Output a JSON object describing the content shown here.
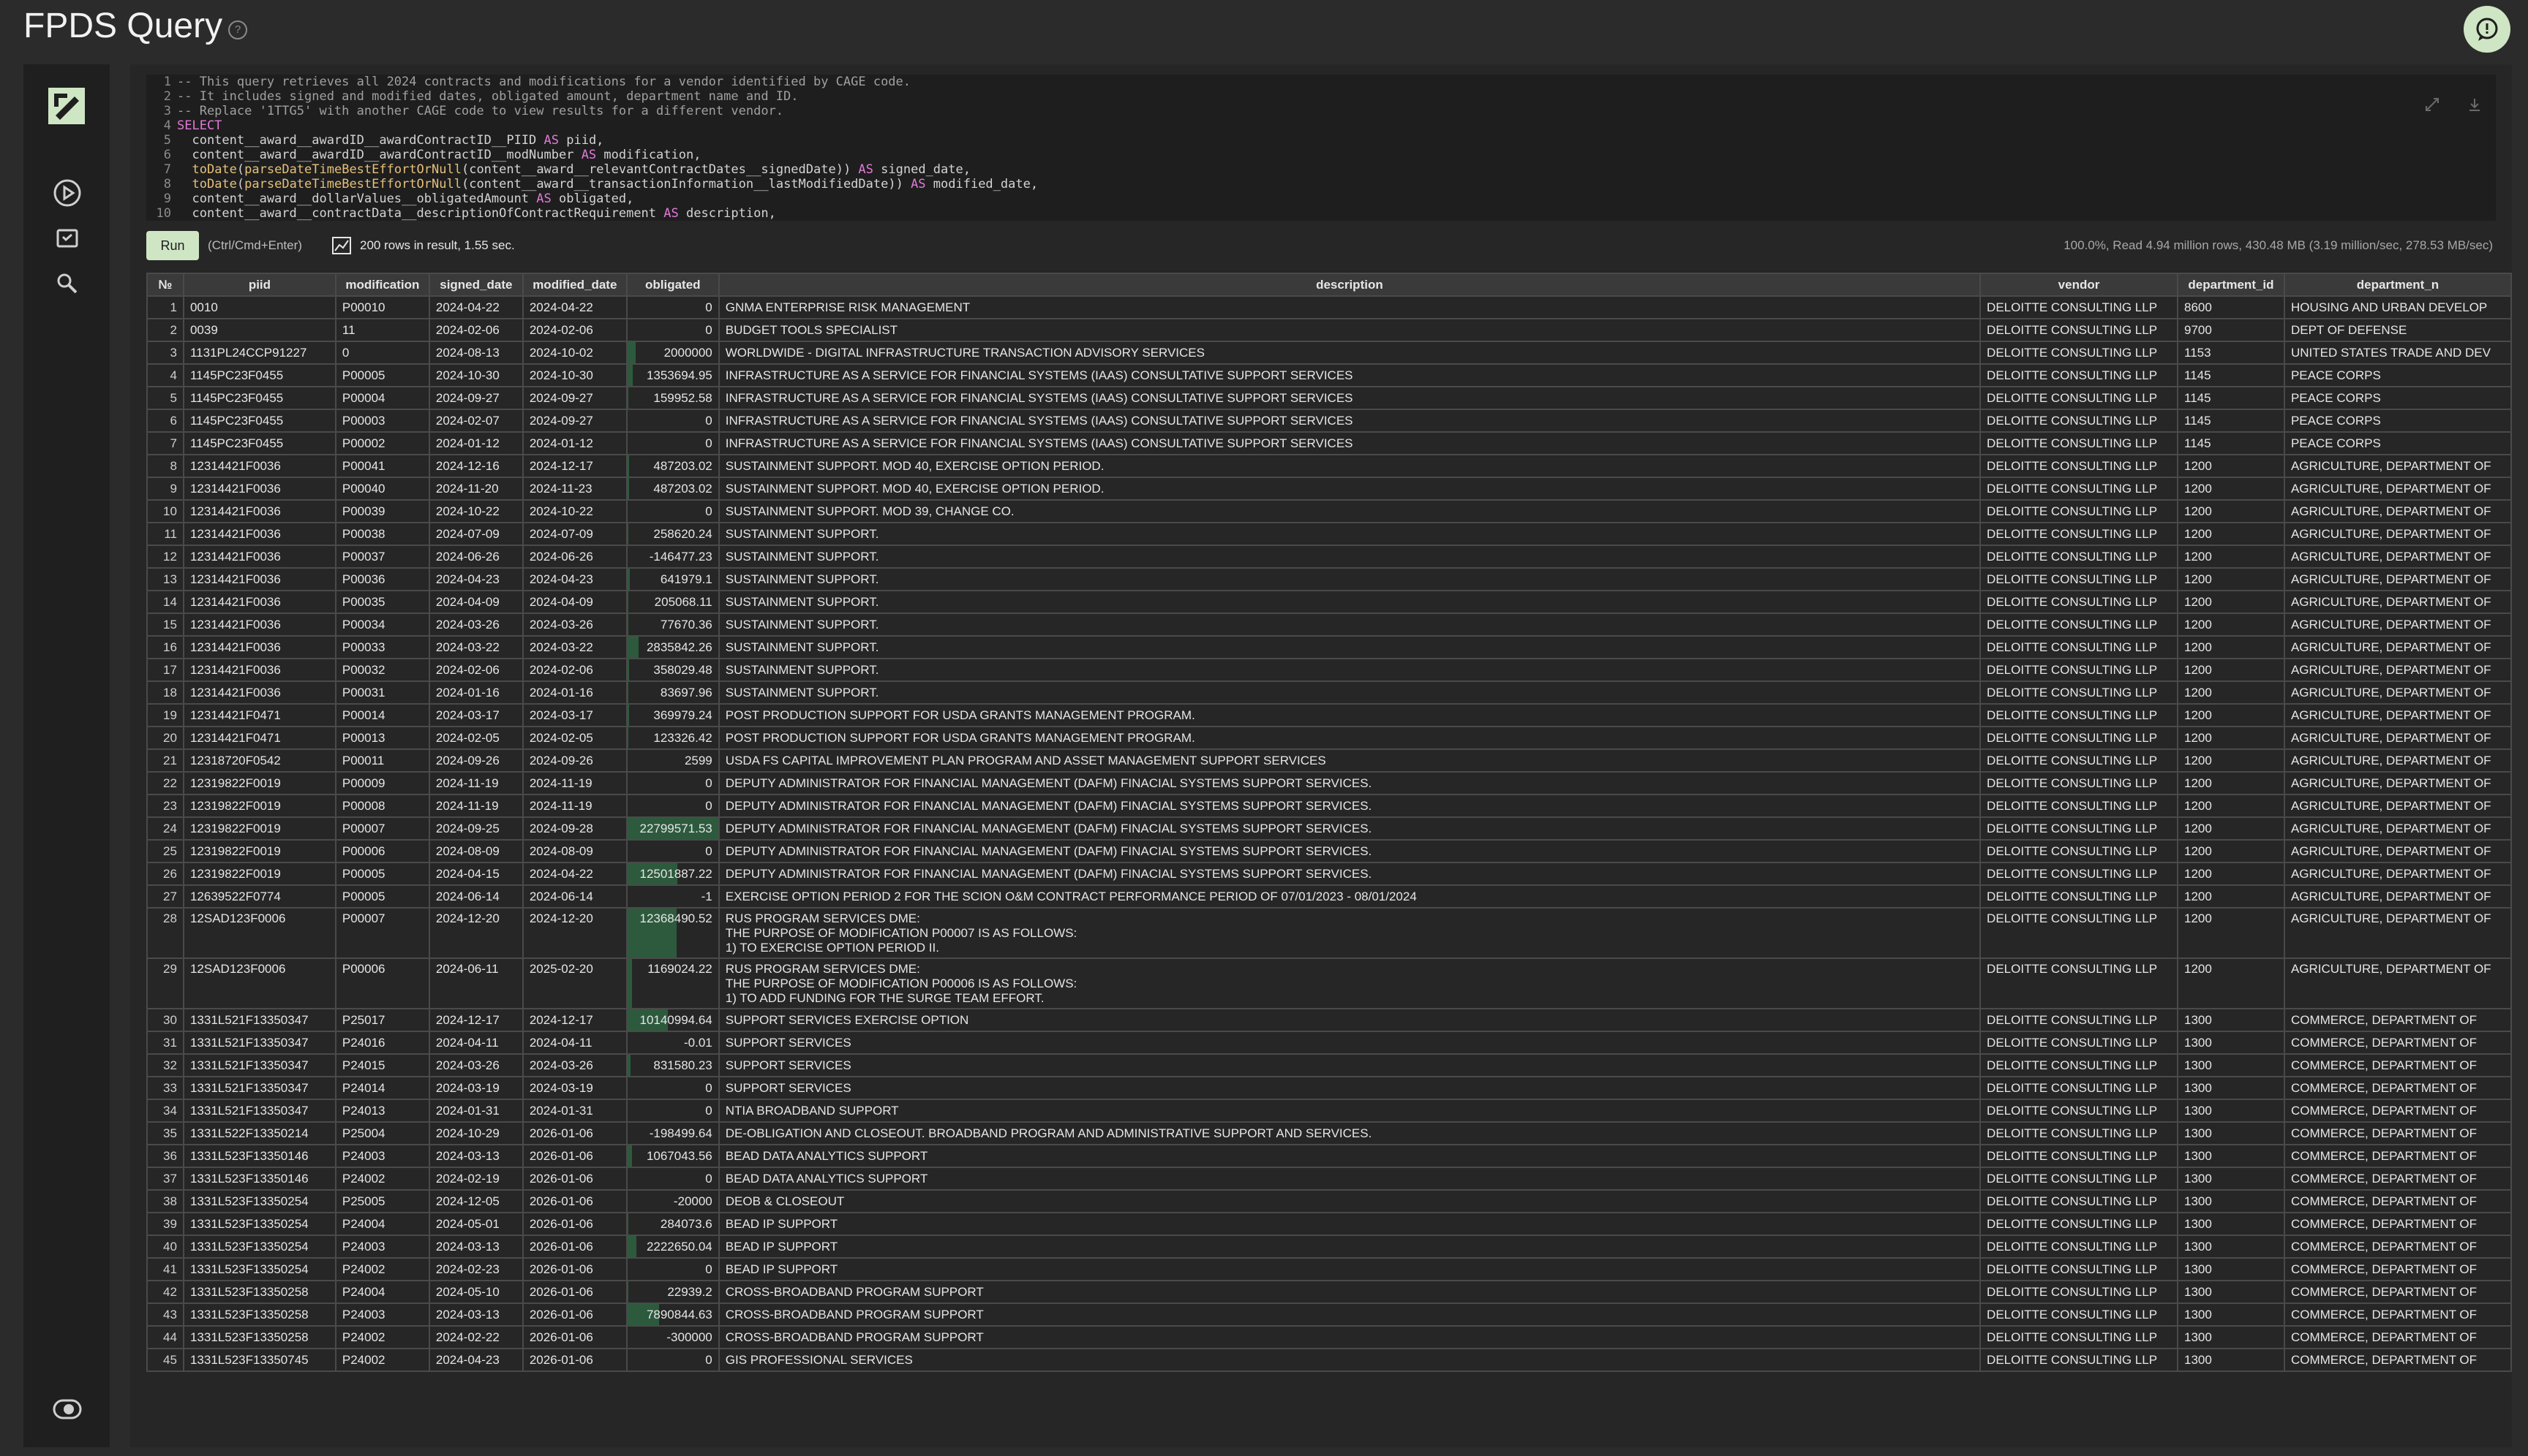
{
  "header": {
    "title": "FPDS Query",
    "help_icon": "?"
  },
  "sidebar": {
    "logo": "clickhouse-logo",
    "items": [
      "play-icon",
      "saved-queries-icon",
      "search-icon",
      "theme-toggle-icon"
    ]
  },
  "editor": {
    "lines": [
      {
        "n": "1",
        "text": "-- This query retrieves all 2024 contracts and modifications for a vendor identified by CAGE code."
      },
      {
        "n": "2",
        "text": "-- It includes signed and modified dates, obligated amount, department name and ID."
      },
      {
        "n": "3",
        "text": "-- Replace '1TTG5' with another CAGE code to view results for a different vendor."
      },
      {
        "n": "4",
        "text": "SELECT"
      },
      {
        "n": "5",
        "text": "  content__award__awardID__awardContractID__PIID AS piid,"
      },
      {
        "n": "6",
        "text": "  content__award__awardID__awardContractID__modNumber AS modification,"
      },
      {
        "n": "7",
        "text": "  toDate(parseDateTimeBestEffortOrNull(content__award__relevantContractDates__signedDate)) AS signed_date,"
      },
      {
        "n": "8",
        "text": "  toDate(parseDateTimeBestEffortOrNull(content__award__transactionInformation__lastModifiedDate)) AS modified_date,"
      },
      {
        "n": "9",
        "text": "  content__award__dollarValues__obligatedAmount AS obligated,"
      },
      {
        "n": "10",
        "text": "  content__award__contractData__descriptionOfContractRequirement AS description,"
      }
    ]
  },
  "toolbar": {
    "run_label": "Run",
    "run_hint": "(Ctrl/Cmd+Enter)",
    "result_summary": "200 rows in result, 1.55 sec.",
    "read_stats": "100.0%, Read 4.94 million rows, 430.48 MB (3.19 million/sec, 278.53 MB/sec)"
  },
  "colors": {
    "bar": "#2d5a3d",
    "accent": "#cfe6c4"
  },
  "table": {
    "columns": [
      "№",
      "piid",
      "modification",
      "signed_date",
      "modified_date",
      "obligated",
      "description",
      "vendor",
      "department_id",
      "department_n"
    ],
    "rows": [
      {
        "n": "1",
        "piid": "0010",
        "mod": "P00010",
        "signed": "2024-04-22",
        "modified": "2024-04-22",
        "obligated": "0",
        "bar": 0,
        "desc": "GNMA ENTERPRISE RISK MANAGEMENT",
        "vendor": "DELOITTE CONSULTING LLP",
        "dept_id": "8600",
        "dept": "HOUSING AND URBAN DEVELOP"
      },
      {
        "n": "2",
        "piid": "0039",
        "mod": "11",
        "signed": "2024-02-06",
        "modified": "2024-02-06",
        "obligated": "0",
        "bar": 0,
        "desc": "BUDGET TOOLS SPECIALIST",
        "vendor": "DELOITTE CONSULTING LLP",
        "dept_id": "9700",
        "dept": "DEPT OF DEFENSE"
      },
      {
        "n": "3",
        "piid": "1131PL24CCP91227",
        "mod": "0",
        "signed": "2024-08-13",
        "modified": "2024-10-02",
        "obligated": "2000000",
        "bar": 0.088,
        "desc": "WORLDWIDE - DIGITAL INFRASTRUCTURE TRANSACTION ADVISORY SERVICES",
        "vendor": "DELOITTE CONSULTING LLP",
        "dept_id": "1153",
        "dept": "UNITED STATES TRADE AND DEV"
      },
      {
        "n": "4",
        "piid": "1145PC23F0455",
        "mod": "P00005",
        "signed": "2024-10-30",
        "modified": "2024-10-30",
        "obligated": "1353694.95",
        "bar": 0.06,
        "desc": "INFRASTRUCTURE AS A SERVICE FOR FINANCIAL SYSTEMS (IAAS) CONSULTATIVE SUPPORT SERVICES",
        "vendor": "DELOITTE CONSULTING LLP",
        "dept_id": "1145",
        "dept": "PEACE CORPS"
      },
      {
        "n": "5",
        "piid": "1145PC23F0455",
        "mod": "P00004",
        "signed": "2024-09-27",
        "modified": "2024-09-27",
        "obligated": "159952.58",
        "bar": 0.007,
        "desc": "INFRASTRUCTURE AS A SERVICE FOR FINANCIAL SYSTEMS (IAAS) CONSULTATIVE SUPPORT SERVICES",
        "vendor": "DELOITTE CONSULTING LLP",
        "dept_id": "1145",
        "dept": "PEACE CORPS"
      },
      {
        "n": "6",
        "piid": "1145PC23F0455",
        "mod": "P00003",
        "signed": "2024-02-07",
        "modified": "2024-09-27",
        "obligated": "0",
        "bar": 0,
        "desc": "INFRASTRUCTURE AS A SERVICE FOR FINANCIAL SYSTEMS (IAAS) CONSULTATIVE SUPPORT SERVICES",
        "vendor": "DELOITTE CONSULTING LLP",
        "dept_id": "1145",
        "dept": "PEACE CORPS"
      },
      {
        "n": "7",
        "piid": "1145PC23F0455",
        "mod": "P00002",
        "signed": "2024-01-12",
        "modified": "2024-01-12",
        "obligated": "0",
        "bar": 0,
        "desc": "INFRASTRUCTURE AS A SERVICE FOR FINANCIAL SYSTEMS (IAAS) CONSULTATIVE SUPPORT SERVICES",
        "vendor": "DELOITTE CONSULTING LLP",
        "dept_id": "1145",
        "dept": "PEACE CORPS"
      },
      {
        "n": "8",
        "piid": "12314421F0036",
        "mod": "P00041",
        "signed": "2024-12-16",
        "modified": "2024-12-17",
        "obligated": "487203.02",
        "bar": 0.021,
        "desc": "SUSTAINMENT SUPPORT. MOD 40, EXERCISE OPTION PERIOD.",
        "vendor": "DELOITTE CONSULTING LLP",
        "dept_id": "1200",
        "dept": "AGRICULTURE, DEPARTMENT OF"
      },
      {
        "n": "9",
        "piid": "12314421F0036",
        "mod": "P00040",
        "signed": "2024-11-20",
        "modified": "2024-11-23",
        "obligated": "487203.02",
        "bar": 0.021,
        "desc": "SUSTAINMENT SUPPORT. MOD 40, EXERCISE OPTION PERIOD.",
        "vendor": "DELOITTE CONSULTING LLP",
        "dept_id": "1200",
        "dept": "AGRICULTURE, DEPARTMENT OF"
      },
      {
        "n": "10",
        "piid": "12314421F0036",
        "mod": "P00039",
        "signed": "2024-10-22",
        "modified": "2024-10-22",
        "obligated": "0",
        "bar": 0,
        "desc": "SUSTAINMENT SUPPORT. MOD 39, CHANGE CO.",
        "vendor": "DELOITTE CONSULTING LLP",
        "dept_id": "1200",
        "dept": "AGRICULTURE, DEPARTMENT OF"
      },
      {
        "n": "11",
        "piid": "12314421F0036",
        "mod": "P00038",
        "signed": "2024-07-09",
        "modified": "2024-07-09",
        "obligated": "258620.24",
        "bar": 0.011,
        "desc": "SUSTAINMENT SUPPORT.",
        "vendor": "DELOITTE CONSULTING LLP",
        "dept_id": "1200",
        "dept": "AGRICULTURE, DEPARTMENT OF"
      },
      {
        "n": "12",
        "piid": "12314421F0036",
        "mod": "P00037",
        "signed": "2024-06-26",
        "modified": "2024-06-26",
        "obligated": "-146477.23",
        "bar": 0,
        "desc": "SUSTAINMENT SUPPORT.",
        "vendor": "DELOITTE CONSULTING LLP",
        "dept_id": "1200",
        "dept": "AGRICULTURE, DEPARTMENT OF"
      },
      {
        "n": "13",
        "piid": "12314421F0036",
        "mod": "P00036",
        "signed": "2024-04-23",
        "modified": "2024-04-23",
        "obligated": "641979.1",
        "bar": 0.028,
        "desc": "SUSTAINMENT SUPPORT.",
        "vendor": "DELOITTE CONSULTING LLP",
        "dept_id": "1200",
        "dept": "AGRICULTURE, DEPARTMENT OF"
      },
      {
        "n": "14",
        "piid": "12314421F0036",
        "mod": "P00035",
        "signed": "2024-04-09",
        "modified": "2024-04-09",
        "obligated": "205068.11",
        "bar": 0.009,
        "desc": "SUSTAINMENT SUPPORT.",
        "vendor": "DELOITTE CONSULTING LLP",
        "dept_id": "1200",
        "dept": "AGRICULTURE, DEPARTMENT OF"
      },
      {
        "n": "15",
        "piid": "12314421F0036",
        "mod": "P00034",
        "signed": "2024-03-26",
        "modified": "2024-03-26",
        "obligated": "77670.36",
        "bar": 0.003,
        "desc": "SUSTAINMENT SUPPORT.",
        "vendor": "DELOITTE CONSULTING LLP",
        "dept_id": "1200",
        "dept": "AGRICULTURE, DEPARTMENT OF"
      },
      {
        "n": "16",
        "piid": "12314421F0036",
        "mod": "P00033",
        "signed": "2024-03-22",
        "modified": "2024-03-22",
        "obligated": "2835842.26",
        "bar": 0.125,
        "desc": "SUSTAINMENT SUPPORT.",
        "vendor": "DELOITTE CONSULTING LLP",
        "dept_id": "1200",
        "dept": "AGRICULTURE, DEPARTMENT OF"
      },
      {
        "n": "17",
        "piid": "12314421F0036",
        "mod": "P00032",
        "signed": "2024-02-06",
        "modified": "2024-02-06",
        "obligated": "358029.48",
        "bar": 0.016,
        "desc": "SUSTAINMENT SUPPORT.",
        "vendor": "DELOITTE CONSULTING LLP",
        "dept_id": "1200",
        "dept": "AGRICULTURE, DEPARTMENT OF"
      },
      {
        "n": "18",
        "piid": "12314421F0036",
        "mod": "P00031",
        "signed": "2024-01-16",
        "modified": "2024-01-16",
        "obligated": "83697.96",
        "bar": 0.004,
        "desc": "SUSTAINMENT SUPPORT.",
        "vendor": "DELOITTE CONSULTING LLP",
        "dept_id": "1200",
        "dept": "AGRICULTURE, DEPARTMENT OF"
      },
      {
        "n": "19",
        "piid": "12314421F0471",
        "mod": "P00014",
        "signed": "2024-03-17",
        "modified": "2024-03-17",
        "obligated": "369979.24",
        "bar": 0.016,
        "desc": "POST PRODUCTION SUPPORT FOR USDA GRANTS MANAGEMENT PROGRAM.",
        "vendor": "DELOITTE CONSULTING LLP",
        "dept_id": "1200",
        "dept": "AGRICULTURE, DEPARTMENT OF"
      },
      {
        "n": "20",
        "piid": "12314421F0471",
        "mod": "P00013",
        "signed": "2024-02-05",
        "modified": "2024-02-05",
        "obligated": "123326.42",
        "bar": 0.005,
        "desc": "POST PRODUCTION SUPPORT FOR USDA GRANTS MANAGEMENT PROGRAM.",
        "vendor": "DELOITTE CONSULTING LLP",
        "dept_id": "1200",
        "dept": "AGRICULTURE, DEPARTMENT OF"
      },
      {
        "n": "21",
        "piid": "12318720F0542",
        "mod": "P00011",
        "signed": "2024-09-26",
        "modified": "2024-09-26",
        "obligated": "2599",
        "bar": 0,
        "desc": "USDA FS CAPITAL IMPROVEMENT PLAN PROGRAM AND ASSET MANAGEMENT SUPPORT SERVICES",
        "vendor": "DELOITTE CONSULTING LLP",
        "dept_id": "1200",
        "dept": "AGRICULTURE, DEPARTMENT OF"
      },
      {
        "n": "22",
        "piid": "12319822F0019",
        "mod": "P00009",
        "signed": "2024-11-19",
        "modified": "2024-11-19",
        "obligated": "0",
        "bar": 0,
        "desc": "DEPUTY ADMINISTRATOR FOR FINANCIAL MANAGEMENT (DAFM) FINACIAL SYSTEMS SUPPORT SERVICES.",
        "vendor": "DELOITTE CONSULTING LLP",
        "dept_id": "1200",
        "dept": "AGRICULTURE, DEPARTMENT OF"
      },
      {
        "n": "23",
        "piid": "12319822F0019",
        "mod": "P00008",
        "signed": "2024-11-19",
        "modified": "2024-11-19",
        "obligated": "0",
        "bar": 0,
        "desc": "DEPUTY ADMINISTRATOR FOR FINANCIAL MANAGEMENT (DAFM) FINACIAL SYSTEMS SUPPORT SERVICES.",
        "vendor": "DELOITTE CONSULTING LLP",
        "dept_id": "1200",
        "dept": "AGRICULTURE, DEPARTMENT OF"
      },
      {
        "n": "24",
        "piid": "12319822F0019",
        "mod": "P00007",
        "signed": "2024-09-25",
        "modified": "2024-09-28",
        "obligated": "22799571.53",
        "bar": 1.0,
        "desc": "DEPUTY ADMINISTRATOR FOR FINANCIAL MANAGEMENT (DAFM) FINACIAL SYSTEMS SUPPORT SERVICES.",
        "vendor": "DELOITTE CONSULTING LLP",
        "dept_id": "1200",
        "dept": "AGRICULTURE, DEPARTMENT OF"
      },
      {
        "n": "25",
        "piid": "12319822F0019",
        "mod": "P00006",
        "signed": "2024-08-09",
        "modified": "2024-08-09",
        "obligated": "0",
        "bar": 0,
        "desc": "DEPUTY ADMINISTRATOR FOR FINANCIAL MANAGEMENT (DAFM) FINACIAL SYSTEMS SUPPORT SERVICES.",
        "vendor": "DELOITTE CONSULTING LLP",
        "dept_id": "1200",
        "dept": "AGRICULTURE, DEPARTMENT OF"
      },
      {
        "n": "26",
        "piid": "12319822F0019",
        "mod": "P00005",
        "signed": "2024-04-15",
        "modified": "2024-04-22",
        "obligated": "12501887.22",
        "bar": 0.548,
        "desc": "DEPUTY ADMINISTRATOR FOR FINANCIAL MANAGEMENT (DAFM) FINACIAL SYSTEMS SUPPORT SERVICES.",
        "vendor": "DELOITTE CONSULTING LLP",
        "dept_id": "1200",
        "dept": "AGRICULTURE, DEPARTMENT OF"
      },
      {
        "n": "27",
        "piid": "12639522F0774",
        "mod": "P00005",
        "signed": "2024-06-14",
        "modified": "2024-06-14",
        "obligated": "-1",
        "bar": 0,
        "desc": "EXERCISE OPTION PERIOD 2 FOR THE SCION O&M CONTRACT PERFORMANCE PERIOD OF 07/01/2023 - 08/01/2024",
        "vendor": "DELOITTE CONSULTING LLP",
        "dept_id": "1200",
        "dept": "AGRICULTURE, DEPARTMENT OF"
      },
      {
        "n": "28",
        "piid": "12SAD123F0006",
        "mod": "P00007",
        "signed": "2024-12-20",
        "modified": "2024-12-20",
        "obligated": "12368490.52",
        "bar": 0.542,
        "desc": "RUS PROGRAM SERVICES DME:\nTHE PURPOSE OF MODIFICATION P00007 IS AS FOLLOWS:\n1) TO EXERCISE OPTION PERIOD II.",
        "multi": true,
        "vendor": "DELOITTE CONSULTING LLP",
        "dept_id": "1200",
        "dept": "AGRICULTURE, DEPARTMENT OF"
      },
      {
        "n": "29",
        "piid": "12SAD123F0006",
        "mod": "P00006",
        "signed": "2024-06-11",
        "modified": "2025-02-20",
        "obligated": "1169024.22",
        "bar": 0.051,
        "desc": "RUS PROGRAM SERVICES DME:\nTHE PURPOSE OF MODIFICATION P00006 IS AS FOLLOWS:\n1) TO ADD FUNDING FOR THE SURGE TEAM EFFORT.",
        "multi": true,
        "vendor": "DELOITTE CONSULTING LLP",
        "dept_id": "1200",
        "dept": "AGRICULTURE, DEPARTMENT OF"
      },
      {
        "n": "30",
        "piid": "1331L521F13350347",
        "mod": "P25017",
        "signed": "2024-12-17",
        "modified": "2024-12-17",
        "obligated": "10140994.64",
        "bar": 0.445,
        "desc": "SUPPORT SERVICES EXERCISE OPTION",
        "vendor": "DELOITTE CONSULTING LLP",
        "dept_id": "1300",
        "dept": "COMMERCE, DEPARTMENT OF"
      },
      {
        "n": "31",
        "piid": "1331L521F13350347",
        "mod": "P24016",
        "signed": "2024-04-11",
        "modified": "2024-04-11",
        "obligated": "-0.01",
        "bar": 0,
        "desc": "SUPPORT SERVICES",
        "vendor": "DELOITTE CONSULTING LLP",
        "dept_id": "1300",
        "dept": "COMMERCE, DEPARTMENT OF"
      },
      {
        "n": "32",
        "piid": "1331L521F13350347",
        "mod": "P24015",
        "signed": "2024-03-26",
        "modified": "2024-03-26",
        "obligated": "831580.23",
        "bar": 0.036,
        "desc": "SUPPORT SERVICES",
        "vendor": "DELOITTE CONSULTING LLP",
        "dept_id": "1300",
        "dept": "COMMERCE, DEPARTMENT OF"
      },
      {
        "n": "33",
        "piid": "1331L521F13350347",
        "mod": "P24014",
        "signed": "2024-03-19",
        "modified": "2024-03-19",
        "obligated": "0",
        "bar": 0,
        "desc": "SUPPORT SERVICES",
        "vendor": "DELOITTE CONSULTING LLP",
        "dept_id": "1300",
        "dept": "COMMERCE, DEPARTMENT OF"
      },
      {
        "n": "34",
        "piid": "1331L521F13350347",
        "mod": "P24013",
        "signed": "2024-01-31",
        "modified": "2024-01-31",
        "obligated": "0",
        "bar": 0,
        "desc": "NTIA BROADBAND SUPPORT",
        "vendor": "DELOITTE CONSULTING LLP",
        "dept_id": "1300",
        "dept": "COMMERCE, DEPARTMENT OF"
      },
      {
        "n": "35",
        "piid": "1331L522F13350214",
        "mod": "P25004",
        "signed": "2024-10-29",
        "modified": "2026-01-06",
        "obligated": "-198499.64",
        "bar": 0,
        "desc": "DE-OBLIGATION AND CLOSEOUT. BROADBAND PROGRAM AND ADMINISTRATIVE SUPPORT AND SERVICES.",
        "vendor": "DELOITTE CONSULTING LLP",
        "dept_id": "1300",
        "dept": "COMMERCE, DEPARTMENT OF"
      },
      {
        "n": "36",
        "piid": "1331L523F13350146",
        "mod": "P24003",
        "signed": "2024-03-13",
        "modified": "2026-01-06",
        "obligated": "1067043.56",
        "bar": 0.047,
        "desc": "BEAD DATA ANALYTICS SUPPORT",
        "vendor": "DELOITTE CONSULTING LLP",
        "dept_id": "1300",
        "dept": "COMMERCE, DEPARTMENT OF"
      },
      {
        "n": "37",
        "piid": "1331L523F13350146",
        "mod": "P24002",
        "signed": "2024-02-19",
        "modified": "2026-01-06",
        "obligated": "0",
        "bar": 0,
        "desc": "BEAD DATA ANALYTICS SUPPORT",
        "vendor": "DELOITTE CONSULTING LLP",
        "dept_id": "1300",
        "dept": "COMMERCE, DEPARTMENT OF"
      },
      {
        "n": "38",
        "piid": "1331L523F13350254",
        "mod": "P25005",
        "signed": "2024-12-05",
        "modified": "2026-01-06",
        "obligated": "-20000",
        "bar": 0,
        "desc": "DEOB & CLOSEOUT",
        "vendor": "DELOITTE CONSULTING LLP",
        "dept_id": "1300",
        "dept": "COMMERCE, DEPARTMENT OF"
      },
      {
        "n": "39",
        "piid": "1331L523F13350254",
        "mod": "P24004",
        "signed": "2024-05-01",
        "modified": "2026-01-06",
        "obligated": "284073.6",
        "bar": 0.012,
        "desc": "BEAD IP SUPPORT",
        "vendor": "DELOITTE CONSULTING LLP",
        "dept_id": "1300",
        "dept": "COMMERCE, DEPARTMENT OF"
      },
      {
        "n": "40",
        "piid": "1331L523F13350254",
        "mod": "P24003",
        "signed": "2024-03-13",
        "modified": "2026-01-06",
        "obligated": "2222650.04",
        "bar": 0.097,
        "desc": "BEAD IP SUPPORT",
        "vendor": "DELOITTE CONSULTING LLP",
        "dept_id": "1300",
        "dept": "COMMERCE, DEPARTMENT OF"
      },
      {
        "n": "41",
        "piid": "1331L523F13350254",
        "mod": "P24002",
        "signed": "2024-02-23",
        "modified": "2026-01-06",
        "obligated": "0",
        "bar": 0,
        "desc": "BEAD IP SUPPORT",
        "vendor": "DELOITTE CONSULTING LLP",
        "dept_id": "1300",
        "dept": "COMMERCE, DEPARTMENT OF"
      },
      {
        "n": "42",
        "piid": "1331L523F13350258",
        "mod": "P24004",
        "signed": "2024-05-10",
        "modified": "2026-01-06",
        "obligated": "22939.2",
        "bar": 0.001,
        "desc": "CROSS-BROADBAND PROGRAM SUPPORT",
        "vendor": "DELOITTE CONSULTING LLP",
        "dept_id": "1300",
        "dept": "COMMERCE, DEPARTMENT OF"
      },
      {
        "n": "43",
        "piid": "1331L523F13350258",
        "mod": "P24003",
        "signed": "2024-03-13",
        "modified": "2026-01-06",
        "obligated": "7890844.63",
        "bar": 0.346,
        "desc": "CROSS-BROADBAND PROGRAM SUPPORT",
        "vendor": "DELOITTE CONSULTING LLP",
        "dept_id": "1300",
        "dept": "COMMERCE, DEPARTMENT OF"
      },
      {
        "n": "44",
        "piid": "1331L523F13350258",
        "mod": "P24002",
        "signed": "2024-02-22",
        "modified": "2026-01-06",
        "obligated": "-300000",
        "bar": 0,
        "desc": "CROSS-BROADBAND PROGRAM SUPPORT",
        "vendor": "DELOITTE CONSULTING LLP",
        "dept_id": "1300",
        "dept": "COMMERCE, DEPARTMENT OF"
      },
      {
        "n": "45",
        "piid": "1331L523F13350745",
        "mod": "P24002",
        "signed": "2024-04-23",
        "modified": "2026-01-06",
        "obligated": "0",
        "bar": 0,
        "desc": "GIS PROFESSIONAL SERVICES",
        "vendor": "DELOITTE CONSULTING LLP",
        "dept_id": "1300",
        "dept": "COMMERCE, DEPARTMENT OF"
      }
    ]
  }
}
